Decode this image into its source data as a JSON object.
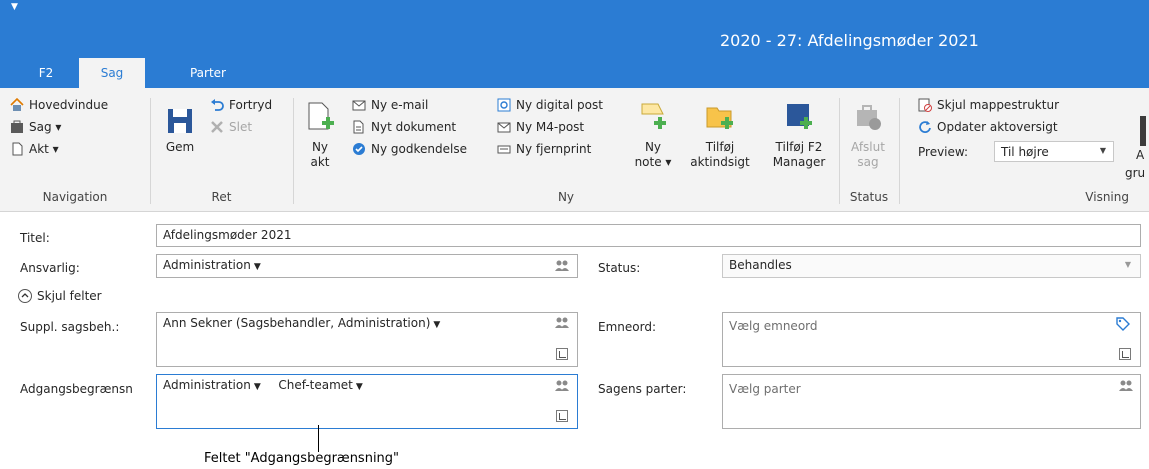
{
  "window": {
    "title": "2020 - 27: Afdelingsmøder 2021",
    "qat_icon": "qat-dropdown-icon"
  },
  "tabs": [
    {
      "label": "F2"
    },
    {
      "label": "Sag",
      "active": true
    },
    {
      "label": "Parter"
    }
  ],
  "ribbon": {
    "navigation": {
      "label": "Navigation",
      "items": [
        {
          "label": "Hovedvindue",
          "icon": "home-icon"
        },
        {
          "label": "Sag ▾",
          "icon": "case-icon"
        },
        {
          "label": "Akt ▾",
          "icon": "document-icon"
        }
      ]
    },
    "ret": {
      "label": "Ret",
      "gem": "Gem",
      "fortryd": "Fortryd",
      "slet": "Slet"
    },
    "ny": {
      "label": "Ny",
      "ny_akt": [
        "Ny",
        "akt"
      ],
      "ny_email": "Ny e-mail",
      "nyt_dokument": "Nyt dokument",
      "ny_godkendelse": "Ny godkendelse",
      "ny_digital_post": "Ny digital post",
      "ny_m4_post": "Ny M4-post",
      "ny_fjernprint": "Ny fjernprint",
      "ny_note": [
        "Ny",
        "note ▾"
      ],
      "tilfoej_aktindsigt": [
        "Tilføj",
        "aktindsigt"
      ],
      "tilfoej_f2_manager": [
        "Tilføj F2",
        "Manager"
      ]
    },
    "status": {
      "label": "Status",
      "afslut_sag": [
        "Afslut",
        "sag"
      ]
    },
    "visning": {
      "label": "Visning",
      "skjul_mappestruktur": "Skjul mappestruktur",
      "opdater_aktoversigt": "Opdater aktoversigt",
      "preview_label": "Preview:",
      "preview_value": "Til højre",
      "extra_partial": [
        "A",
        "gru"
      ]
    }
  },
  "form": {
    "titel": {
      "label": "Titel:",
      "value": "Afdelingsmøder 2021"
    },
    "ansvarlig": {
      "label": "Ansvarlig:",
      "value": "Administration"
    },
    "status": {
      "label": "Status:",
      "value": "Behandles"
    },
    "skjul_felter": "Skjul felter",
    "suppl": {
      "label": "Suppl. sagsbeh.:",
      "value": "Ann Sekner (Sagsbehandler, Administration)"
    },
    "emneord": {
      "label": "Emneord:",
      "placeholder": "Vælg emneord"
    },
    "adgang": {
      "label": "Adgangsbegrænsn",
      "values": [
        "Administration",
        "Chef-teamet"
      ]
    },
    "parter": {
      "label": "Sagens parter:",
      "placeholder": "Vælg parter"
    }
  },
  "callout": "Feltet \"Adgangsbegrænsning\"",
  "colors": {
    "accent": "#2b7cd3",
    "ribbon_bg": "#f3f3f3",
    "green": "#4caf50"
  }
}
